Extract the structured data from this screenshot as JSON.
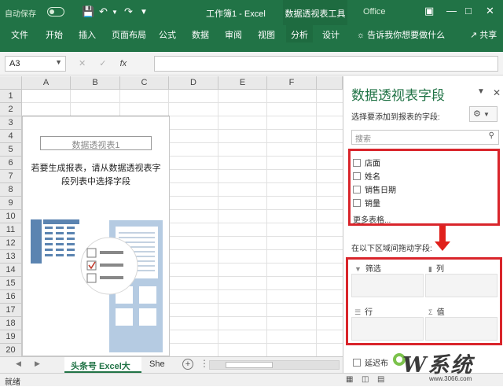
{
  "titlebar": {
    "autosave_label": "自动保存",
    "window_title": "工作簿1 - Excel",
    "context_tool": "数据透视表工具",
    "office_label": "Office"
  },
  "ribbon": {
    "tabs": [
      "文件",
      "开始",
      "插入",
      "页面布局",
      "公式",
      "数据",
      "审阅",
      "视图",
      "分析",
      "设计"
    ],
    "selected_tab": "分析",
    "tell_me": "告诉我你想要做什么",
    "share": "共享"
  },
  "formula_bar": {
    "name_box": "A3",
    "fx_label": "fx",
    "formula": ""
  },
  "sheet": {
    "columns": [
      "A",
      "B",
      "C",
      "D",
      "E",
      "F"
    ],
    "rows": [
      "1",
      "2",
      "3",
      "4",
      "5",
      "6",
      "7",
      "8",
      "9",
      "10",
      "11",
      "12",
      "13",
      "14",
      "15",
      "16",
      "17",
      "18",
      "19",
      "20"
    ],
    "pivot_placeholder": {
      "name": "数据透视表1",
      "message_line1": "若要生成报表，请从数据透视表字",
      "message_line2": "段列表中选择字段"
    }
  },
  "sheet_tabs": {
    "active": "头条号 Excel大全",
    "other": "She"
  },
  "status": {
    "ready": "就绪"
  },
  "pivot_panel": {
    "title": "数据透视表字段",
    "choose_label": "选择要添加到报表的字段:",
    "search_placeholder": "搜索",
    "fields": [
      "店面",
      "姓名",
      "销售日期",
      "销量"
    ],
    "more_tables": "更多表格...",
    "drag_label": "在以下区域间拖动字段:",
    "areas": {
      "filters": "筛选",
      "columns": "列",
      "rows": "行",
      "values": "值"
    },
    "defer_label": "延迟布"
  },
  "watermark": {
    "text": "W系统",
    "url": "www.3066.com"
  },
  "colors": {
    "excel_green": "#217346",
    "highlight_red": "#d9252b"
  }
}
